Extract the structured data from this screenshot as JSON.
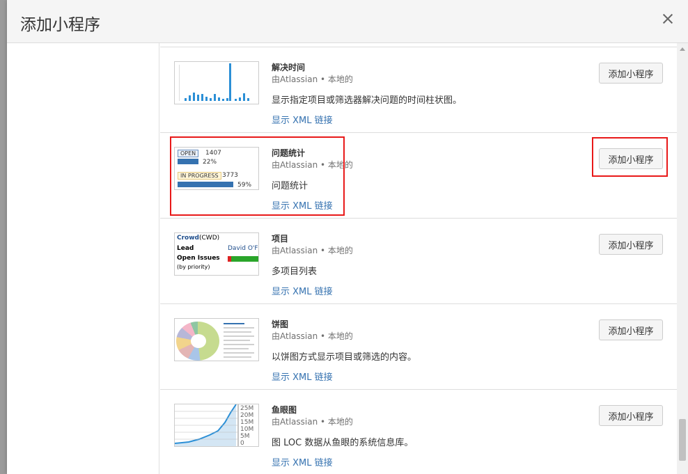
{
  "dialog": {
    "title": "添加小程序"
  },
  "gadgets": [
    {
      "name": "解决时间",
      "author": "由Atlassian • 本地的",
      "description": "显示指定项目或筛选器解决问题的时间柱状图。",
      "xml_link": "显示 XML 链接",
      "add_label": "添加小程序"
    },
    {
      "name": "问题统计",
      "author": "由Atlassian • 本地的",
      "description": "问题统计",
      "xml_link": "显示 XML 链接",
      "add_label": "添加小程序",
      "stats": {
        "open_label": "OPEN",
        "open_count": "1407",
        "open_pct": "22%",
        "progress_label": "IN PROGRESS",
        "progress_count": "3773",
        "progress_pct": "59%"
      }
    },
    {
      "name": "项目",
      "author": "由Atlassian • 本地的",
      "description": "多项目列表",
      "xml_link": "显示 XML 链接",
      "add_label": "添加小程序",
      "project": {
        "name": "Crowd",
        "key": "(CWD)",
        "lead_label": "Lead",
        "lead_value": "David O'Fly",
        "issues_label": "Open Issues",
        "issues_sub": "(by priority)"
      }
    },
    {
      "name": "饼图",
      "author": "由Atlassian • 本地的",
      "description": "以饼图方式显示项目或筛选的内容。",
      "xml_link": "显示 XML 链接",
      "add_label": "添加小程序"
    },
    {
      "name": "鱼眼图",
      "author": "由Atlassian • 本地的",
      "description": "图 LOC 数据从鱼眼的系统信息库。",
      "xml_link": "显示 XML 链接",
      "add_label": "添加小程序",
      "axis_labels": [
        "25M",
        "20M",
        "15M",
        "10M",
        "5M",
        "0"
      ]
    }
  ],
  "colors": {
    "link": "#3572b0",
    "highlight": "#e81919",
    "bar": "#2b8fd6"
  }
}
